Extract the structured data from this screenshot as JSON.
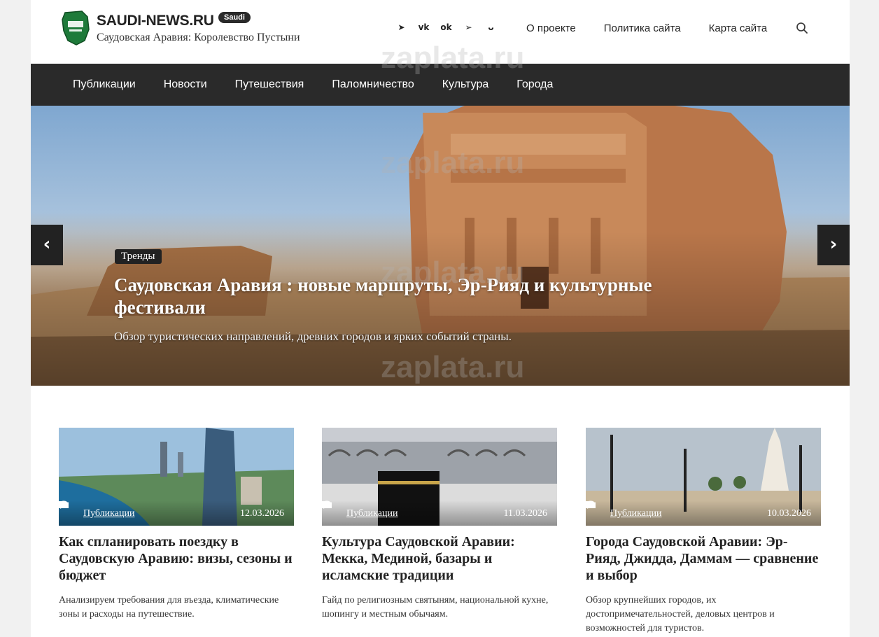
{
  "header": {
    "site_name": "SAUDI-NEWS.RU",
    "badge": "Saudi",
    "tagline": "Саудовская Аравия: Королевство Пустыни",
    "socials": [
      {
        "icon": "livejournal-icon",
        "glyph": "➤"
      },
      {
        "icon": "vk-icon",
        "glyph": "vk"
      },
      {
        "icon": "odnoklassniki-icon",
        "glyph": "ok"
      },
      {
        "icon": "telegram-icon",
        "glyph": "➢"
      },
      {
        "icon": "smile-icon",
        "glyph": "ᴗ"
      }
    ],
    "links": [
      "О проекте",
      "Политика сайта",
      "Карта сайта"
    ]
  },
  "nav": {
    "items": [
      "Публикации",
      "Новости",
      "Путешествия",
      "Паломничество",
      "Культура",
      "Города"
    ]
  },
  "hero": {
    "tag": "Тренды",
    "title": "Саудовская Аравия : новые маршруты, Эр-Рияд и культурные фестивали",
    "subtitle": "Обзор туристических направлений, древних городов и ярких событий страны.",
    "prev": "‹",
    "next": "›"
  },
  "cards": [
    {
      "category": "Публикации",
      "date": "12.03.2026",
      "title": "Как спланировать поездку в Саудовскую Аравию: визы, сезоны и бюджет",
      "desc": "Анализируем требования для въезда, климатические зоны и расходы на путешествие."
    },
    {
      "category": "Публикации",
      "date": "11.03.2026",
      "title": "Культура Саудовской Аравии: Мекка, Мединой, базары и исламские традиции",
      "desc": "Гайд по религиозным святыням, национальной кухне, шопингу и местным обычаям."
    },
    {
      "category": "Публикации",
      "date": "10.03.2026",
      "title": "Города Саудовской Аравии: Эр-Рияд, Джидда, Даммам — сравнение и выбор",
      "desc": "Обзор крупнейших городов, их достопримечательностей, деловых центров и возможностей для туристов."
    }
  ],
  "watermark": "zaplata.ru",
  "colors": {
    "nav_bg": "#2a2a2a",
    "logo_green": "#1e7a3a"
  }
}
